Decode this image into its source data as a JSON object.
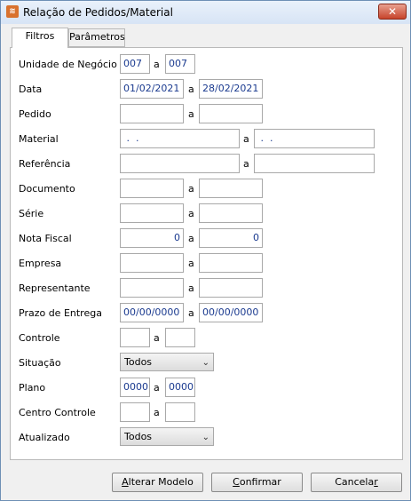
{
  "window": {
    "title": "Relação de Pedidos/Material",
    "app_icon": "report-icon",
    "close_symbol": "✕"
  },
  "tabs": [
    {
      "label": "Filtros",
      "active": true
    },
    {
      "label": "Parâmetros",
      "active": false
    }
  ],
  "separator": "a",
  "fields": {
    "unidade": {
      "label": "Unidade de Negócio",
      "from": "007",
      "to": "007"
    },
    "data": {
      "label": "Data",
      "from": "01/02/2021",
      "to": "28/02/2021"
    },
    "pedido": {
      "label": "Pedido",
      "from": "",
      "to": ""
    },
    "material": {
      "label": "Material",
      "from": " .  .",
      "to": " .  ."
    },
    "referencia": {
      "label": "Referência",
      "from": "",
      "to": ""
    },
    "documento": {
      "label": "Documento",
      "from": "",
      "to": ""
    },
    "serie": {
      "label": "Série",
      "from": "",
      "to": ""
    },
    "nota_fiscal": {
      "label": "Nota Fiscal",
      "from": "0",
      "to": "0"
    },
    "empresa": {
      "label": "Empresa",
      "from": "",
      "to": ""
    },
    "representante": {
      "label": "Representante",
      "from": "",
      "to": ""
    },
    "prazo_entrega": {
      "label": "Prazo de Entrega",
      "from": "00/00/0000",
      "to": "00/00/0000"
    },
    "controle": {
      "label": "Controle",
      "from": "",
      "to": ""
    },
    "situacao": {
      "label": "Situação",
      "value": "Todos"
    },
    "plano": {
      "label": "Plano",
      "from": "0000",
      "to": "0000"
    },
    "centro_controle": {
      "label": "Centro Controle",
      "from": "",
      "to": ""
    },
    "atualizado": {
      "label": "Atualizado",
      "value": "Todos"
    }
  },
  "buttons": {
    "alterar": {
      "mnemonic": "A",
      "rest": "lterar Modelo"
    },
    "confirmar": {
      "mnemonic": "C",
      "rest": "onfirmar"
    },
    "cancelar": {
      "prefix": "Cancela",
      "mnemonic": "r"
    }
  }
}
